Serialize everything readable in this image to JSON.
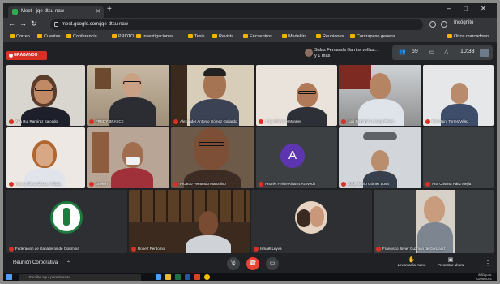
{
  "browser": {
    "tab_title": "Meet - jqe-dtsu-naw",
    "address": "meet.google.com/jqe-dtsu-naw",
    "profile_label": "Incógnito",
    "bookmarks": [
      "Correo",
      "Cuentas",
      "Conferencia",
      "PROTO",
      "Investigaciones",
      "Tesis",
      "Revista",
      "Encuentros",
      "Medellín",
      "Reuniones",
      "Contrapeso general"
    ],
    "other_bookmarks": "Otros marcadores"
  },
  "meet": {
    "recording_label": "GRABANDO",
    "presenter_name": "Salas Fernanda Barrios vellas...",
    "presenter_sub": "y 1 más",
    "participant_count": "59",
    "time": "10:33",
    "meeting_name": "Reunión Corporativa",
    "participants": [
      "Ana Rut Ramírez Salcedo",
      "FREDY BRAYCE",
      "Alexander Antonio Gómez Gallardo",
      "Jorge Enrique Morales",
      "Luis Fernando Arango Pérez",
      "Bert Jairo Torres Vélez",
      "Francy Elena Duque Villada",
      "Eneko P.",
      "Ricardo Fernando Marcelino",
      "Andrés Felipe Alvarez Acevedo",
      "Jorge Mario Gómez Luna",
      "Ana Cristina Páez Mejía",
      "Federación de Ganaderos de Colombia",
      "Robert Perdomo",
      "Ismaël Leyva",
      "Francisco Javier Guzmán de Gonzalez"
    ],
    "avatar_letter": "A",
    "bottom_actions": [
      "Levantar la mano",
      "Presentar ahora"
    ]
  },
  "taskbar": {
    "search_placeholder": "Escribe aquí para buscar",
    "time": "8:51 p.m.",
    "date": "22/09/2021"
  },
  "colors": {
    "meet_bg": "#202124",
    "recording_red": "#d93025",
    "avatar_purple": "#5e35b1"
  }
}
